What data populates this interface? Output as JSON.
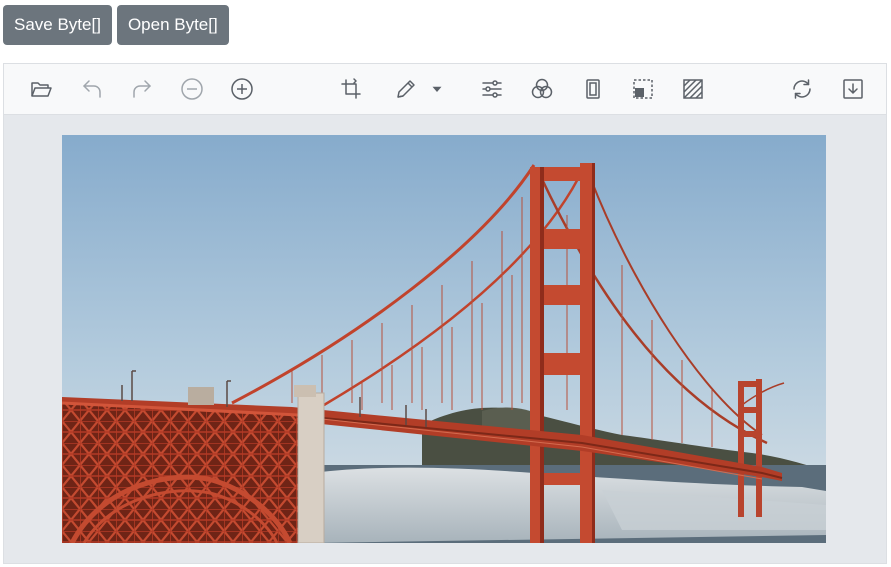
{
  "app": {
    "buttons": {
      "save_label": "Save Byte[]",
      "open_label": "Open Byte[]"
    }
  },
  "toolbar": {
    "icons": [
      "folder-open-icon",
      "undo-icon",
      "redo-icon",
      "zoom-out-icon",
      "zoom-in-icon",
      "crop-icon",
      "pencil-icon",
      "chevron-down-icon",
      "adjust-sliders-icon",
      "filter-circles-icon",
      "frame-icon",
      "selection-icon",
      "hatch-pattern-icon",
      "reset-icon",
      "download-icon"
    ],
    "icon_color": "#5b6168",
    "disabled_icon_color": "#a0a6ac"
  },
  "image": {
    "subject": "Golden Gate Bridge photograph",
    "bridge_color": "#c1432c",
    "sky_color": "#a9c6dc"
  },
  "theme": {
    "button_bg": "#6c757d",
    "canvas_bg": "#e5e8ec",
    "toolbar_bg": "#f8f9fa"
  }
}
